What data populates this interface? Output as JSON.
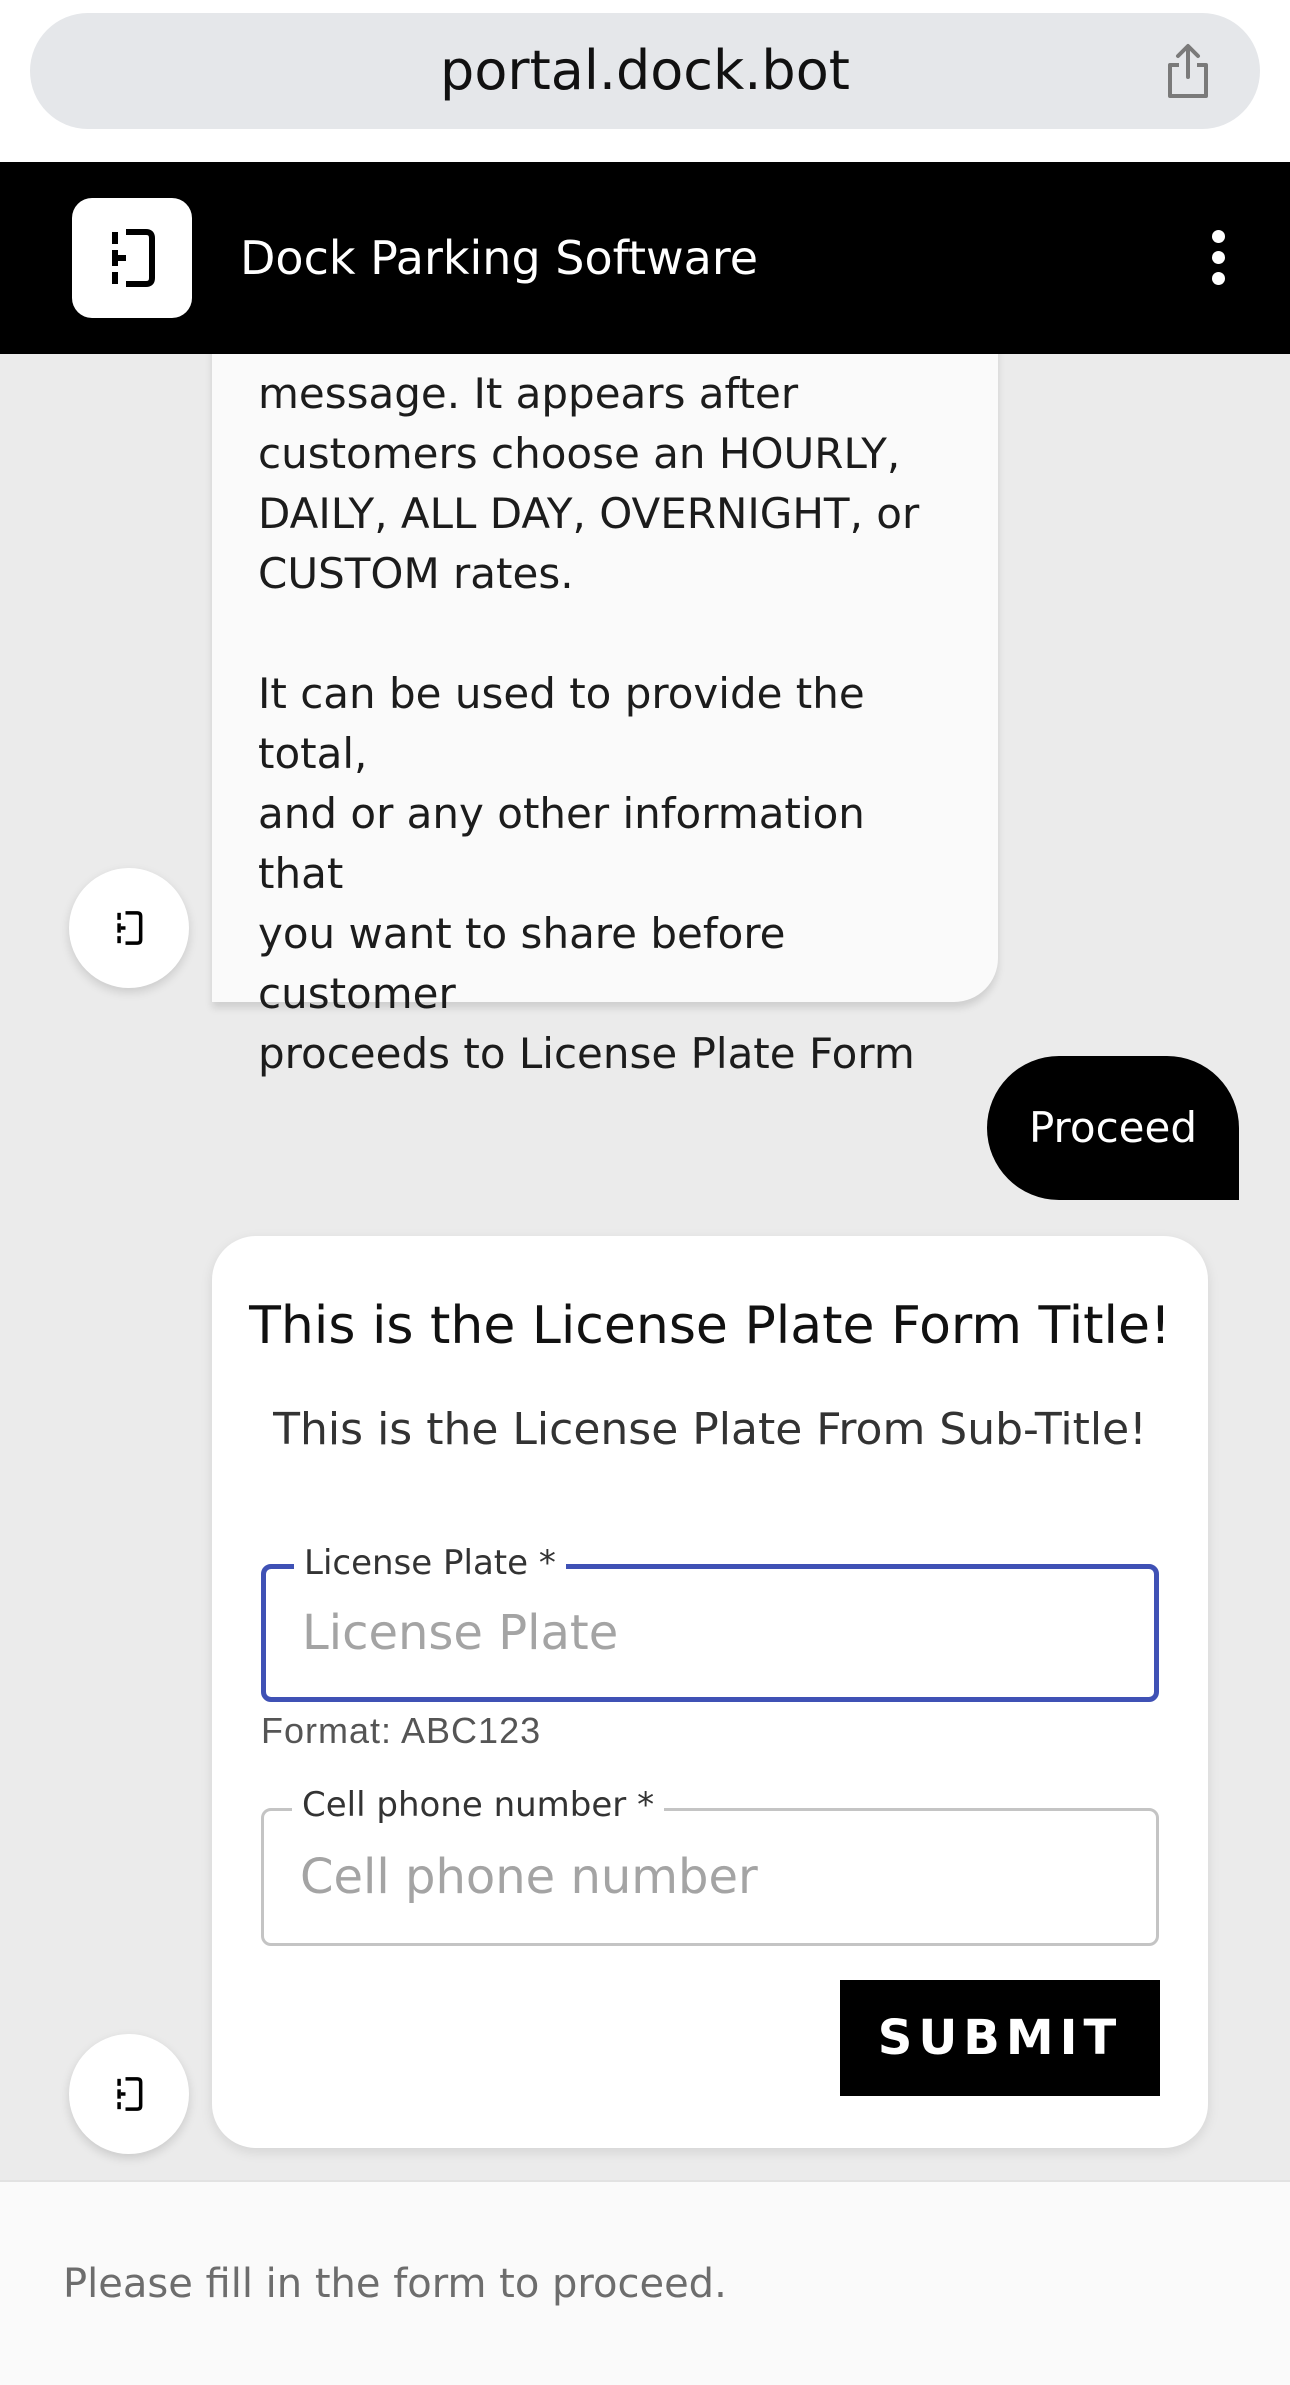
{
  "browser": {
    "url": "portal.dock.bot",
    "share_icon": "share-icon"
  },
  "header": {
    "title": "Dock Parking Software",
    "logo_icon": "dock-logo-icon",
    "menu_icon": "kebab-menu-icon"
  },
  "chat": {
    "bot_message": "message. It appears after\ncustomers choose an HOURLY,\nDAILY, ALL DAY, OVERNIGHT, or\nCUSTOM rates.\n\nIt can be used to provide the total,\nand or any other information that\nyou want to share before customer\nproceeds to License Plate Form",
    "user_reply": "Proceed"
  },
  "form": {
    "title": "This is the License Plate Form Title!",
    "subtitle": "This is the License Plate From Sub-Title!",
    "fields": [
      {
        "label": "License Plate",
        "required_mark": "*",
        "placeholder": "License Plate",
        "value": "",
        "helper": "Format: ABC123"
      },
      {
        "label": "Cell phone number",
        "required_mark": "*",
        "placeholder": "Cell phone number",
        "value": ""
      }
    ],
    "submit_label": "SUBMIT"
  },
  "footer": {
    "placeholder": "Please fill in the form to proceed."
  },
  "colors": {
    "header_bg": "#000000",
    "page_bg": "#ebebeb",
    "focus_border": "#3f51b5",
    "button_bg": "#000000"
  }
}
